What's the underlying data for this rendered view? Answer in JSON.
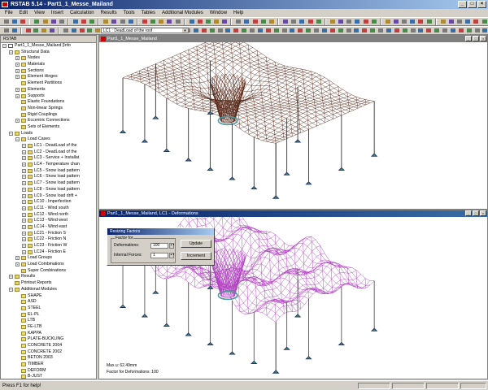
{
  "window": {
    "title": "RSTAB 5.14 - Part1_1_Messe_Mailand"
  },
  "menu": [
    "File",
    "Edit",
    "View",
    "Insert",
    "Calculation",
    "Results",
    "Tools",
    "Tables",
    "Additional Modules",
    "Window",
    "Help"
  ],
  "toolbar": {
    "loadcase_select": "LC1 : DeadLoad of the roof"
  },
  "navigator": {
    "header": "RSTAB",
    "items": [
      {
        "label": "Part1_1_Messe_Mailand [Info",
        "level": 0,
        "icon": "doc",
        "exp": "-"
      },
      {
        "label": "Structural Data",
        "level": 1,
        "icon": "folder",
        "exp": "-"
      },
      {
        "label": "Nodes",
        "level": 2,
        "icon": "folder",
        "exp": "+"
      },
      {
        "label": "Materials",
        "level": 2,
        "icon": "folder",
        "exp": "+"
      },
      {
        "label": "Sections",
        "level": 2,
        "icon": "folder",
        "exp": "+"
      },
      {
        "label": "Element Hinges",
        "level": 2,
        "icon": "folder",
        "exp": "+"
      },
      {
        "label": "Element Partitions",
        "level": 2,
        "icon": "folder",
        "exp": ""
      },
      {
        "label": "Elements",
        "level": 2,
        "icon": "folder",
        "exp": "+"
      },
      {
        "label": "Supports",
        "level": 2,
        "icon": "folder",
        "exp": "+"
      },
      {
        "label": "Elastic Foundations",
        "level": 2,
        "icon": "folder",
        "exp": ""
      },
      {
        "label": "Non-linear Springs",
        "level": 2,
        "icon": "folder",
        "exp": ""
      },
      {
        "label": "Rigid Couplings",
        "level": 2,
        "icon": "folder",
        "exp": ""
      },
      {
        "label": "Eccentric Connections",
        "level": 2,
        "icon": "folder",
        "exp": "+"
      },
      {
        "label": "Sets of Elements",
        "level": 2,
        "icon": "folder",
        "exp": ""
      },
      {
        "label": "Loads",
        "level": 1,
        "icon": "folder",
        "exp": "-"
      },
      {
        "label": "Load Cases",
        "level": 2,
        "icon": "folder",
        "exp": "-"
      },
      {
        "label": "LC1 - DeadLoad of the",
        "level": 3,
        "icon": "folder",
        "exp": "+"
      },
      {
        "label": "LC2 - DeadLoad of the",
        "level": 3,
        "icon": "folder",
        "exp": "+"
      },
      {
        "label": "LC3 - Service + Installat",
        "level": 3,
        "icon": "folder",
        "exp": "+"
      },
      {
        "label": "LC4 - Temperature chan",
        "level": 3,
        "icon": "folder",
        "exp": "+"
      },
      {
        "label": "LC5 - Snow  load pattern",
        "level": 3,
        "icon": "folder",
        "exp": "+"
      },
      {
        "label": "LC6 - Snow  load pattern",
        "level": 3,
        "icon": "folder",
        "exp": "+"
      },
      {
        "label": "LC7 - Snow  load pattern",
        "level": 3,
        "icon": "folder",
        "exp": "+"
      },
      {
        "label": "LC8 - Snow  load pattern",
        "level": 3,
        "icon": "folder",
        "exp": "+"
      },
      {
        "label": "LC9 - Snow  load drift +",
        "level": 3,
        "icon": "folder",
        "exp": "+"
      },
      {
        "label": "LC10 - Imperfection",
        "level": 3,
        "icon": "folder",
        "exp": "+"
      },
      {
        "label": "LC11 - Wind south",
        "level": 3,
        "icon": "folder",
        "exp": "+"
      },
      {
        "label": "LC12 - Wind north",
        "level": 3,
        "icon": "folder",
        "exp": "+"
      },
      {
        "label": "LC13 - Wind west",
        "level": 3,
        "icon": "folder",
        "exp": "+"
      },
      {
        "label": "LC14 - Wind east",
        "level": 3,
        "icon": "folder",
        "exp": "+"
      },
      {
        "label": "LC21 - Friction S",
        "level": 3,
        "icon": "folder",
        "exp": "+"
      },
      {
        "label": "LC22 - Friction N",
        "level": 3,
        "icon": "folder",
        "exp": "+"
      },
      {
        "label": "LC23 - Friction W",
        "level": 3,
        "icon": "folder",
        "exp": "+"
      },
      {
        "label": "LC24 - Friction E",
        "level": 3,
        "icon": "folder",
        "exp": "+"
      },
      {
        "label": "Load Groups",
        "level": 2,
        "icon": "folder",
        "exp": "+"
      },
      {
        "label": "Load Combinations",
        "level": 2,
        "icon": "folder",
        "exp": "+"
      },
      {
        "label": "Super Combinations",
        "level": 2,
        "icon": "folder",
        "exp": ""
      },
      {
        "label": "Results",
        "level": 1,
        "icon": "folder",
        "exp": "+"
      },
      {
        "label": "Printout Reports",
        "level": 1,
        "icon": "folder",
        "exp": ""
      },
      {
        "label": "Additional Modules",
        "level": 1,
        "icon": "folder",
        "exp": "-"
      },
      {
        "label": "SHAPE",
        "level": 2,
        "icon": "mod",
        "exp": ""
      },
      {
        "label": "ASD",
        "level": 2,
        "icon": "mod",
        "exp": ""
      },
      {
        "label": "STEEL",
        "level": 2,
        "icon": "mod",
        "exp": ""
      },
      {
        "label": "EL-PL",
        "level": 2,
        "icon": "mod",
        "exp": ""
      },
      {
        "label": "LTB",
        "level": 2,
        "icon": "mod",
        "exp": ""
      },
      {
        "label": "FE-LTB",
        "level": 2,
        "icon": "mod",
        "exp": ""
      },
      {
        "label": "KAPPA",
        "level": 2,
        "icon": "mod",
        "exp": ""
      },
      {
        "label": "PLATE-BUCKLING",
        "level": 2,
        "icon": "mod",
        "exp": ""
      },
      {
        "label": "CONCRETE 2004",
        "level": 2,
        "icon": "mod",
        "exp": ""
      },
      {
        "label": "CONCRETE 2002",
        "level": 2,
        "icon": "mod",
        "exp": ""
      },
      {
        "label": "BETON 2003",
        "level": 2,
        "icon": "mod",
        "exp": ""
      },
      {
        "label": "TIMBER",
        "level": 2,
        "icon": "mod",
        "exp": ""
      },
      {
        "label": "DEFORM",
        "level": 2,
        "icon": "mod",
        "exp": ""
      },
      {
        "label": "B-JUST",
        "level": 2,
        "icon": "mod",
        "exp": ""
      }
    ]
  },
  "view1": {
    "title": "Part1_1_Messe_Mailand",
    "mesh_color": "#5a2a1a"
  },
  "view2": {
    "title": "Part1_1_Messe_Mailand, LC1 - Deformations",
    "mesh_color": "#b040c0",
    "info_max": "Max u: 62.49mm",
    "info_factor": "Factor for Deformations: 100"
  },
  "dialog": {
    "title": "Resizing Factors",
    "group_label": "Factor for",
    "deformations_label": "Deformations:",
    "deformations_value": "100",
    "internal_forces_label": "Internal Forces:",
    "internal_forces_value": "1",
    "update_button": "Update",
    "increment_button": "Increment"
  },
  "status": {
    "text": "Press F1 for help!"
  },
  "colors": {
    "titlebar": "#0a246a",
    "support": "#4a9aa0"
  }
}
